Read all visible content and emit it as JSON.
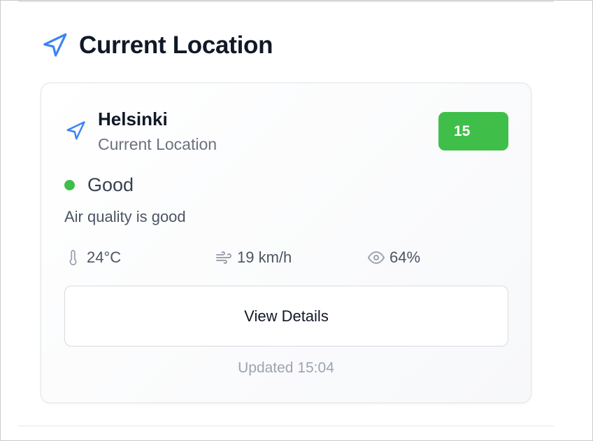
{
  "section": {
    "title": "Current Location",
    "icon": "navigation-arrow-icon"
  },
  "card": {
    "city": "Helsinki",
    "subtitle": "Current Location",
    "aqi_value": "15",
    "status": {
      "label": "Good",
      "description": "Air quality is good",
      "color": "#3fbf4a"
    },
    "metrics": {
      "temperature": "24°C",
      "wind": "19 km/h",
      "humidity": "64%"
    },
    "button_label": "View Details",
    "updated": "Updated 15:04"
  },
  "colors": {
    "accent": "#3b82f6",
    "good": "#3fbf4a"
  }
}
